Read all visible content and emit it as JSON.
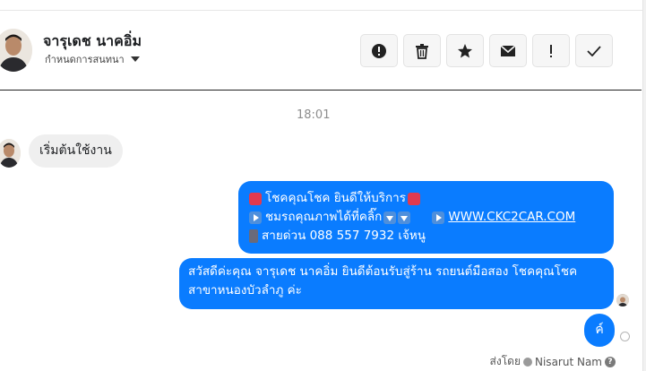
{
  "header": {
    "name": "จารุเดช นาคอิ่ม",
    "assign_label": "กำหนดการสนทนา",
    "actions": [
      {
        "icon": "alert-circle-icon"
      },
      {
        "icon": "trash-icon"
      },
      {
        "icon": "star-icon"
      },
      {
        "icon": "envelope-icon"
      },
      {
        "icon": "exclamation-icon"
      },
      {
        "icon": "check-icon"
      }
    ]
  },
  "conversation": {
    "timestamp": "18:01",
    "incoming": [
      {
        "text": "เริ่มต้นใช้งาน"
      }
    ],
    "outgoing": [
      {
        "line1": "โชคคุณโชค ยินดีให้บริการ",
        "line2_text": "ชมรถคุณภาพได้ที่คลิ๊ก",
        "line2_link": "WWW.CKC2CAR.COM",
        "line3": "สายด่วน 088 557 7932 เจ้หนู"
      },
      {
        "text": "สวัสดีค่ะคุณ จารุเดช นาคอิ่ม ยินดีต้อนรับสู่ร้าน รถยนต์มือสอง โชคคุณโชค สาขาหนองบัวลำภู ค่ะ"
      },
      {
        "text": "ค์"
      }
    ],
    "sent_by_label": "ส่งโดย",
    "sent_by_name": "Nisarut Nam"
  },
  "colors": {
    "outgoing_bubble": "#0a7cff",
    "incoming_bubble": "#efefef"
  }
}
